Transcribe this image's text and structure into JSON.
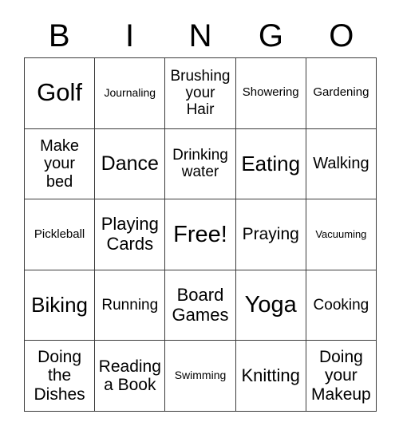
{
  "card": {
    "title_letters": [
      "B",
      "I",
      "N",
      "G",
      "O"
    ],
    "grid": {
      "columns": 5,
      "rows": 5,
      "line_color": "#3b3b3b",
      "background_color": "#ffffff",
      "text_color": "#000000"
    },
    "cells": [
      [
        {
          "label": "Golf",
          "size": "fs-31"
        },
        {
          "label": "Journaling",
          "size": "fs-14"
        },
        {
          "label": "Brushing\nyour\nHair",
          "size": "fs-19"
        },
        {
          "label": "Showering",
          "size": "fs-15"
        },
        {
          "label": "Gardening",
          "size": "fs-15"
        }
      ],
      [
        {
          "label": "Make\nyour\nbed",
          "size": "fs-20"
        },
        {
          "label": "Dance",
          "size": "fs-25"
        },
        {
          "label": "Drinking\nwater",
          "size": "fs-19"
        },
        {
          "label": "Eating",
          "size": "fs-26"
        },
        {
          "label": "Walking",
          "size": "fs-20"
        }
      ],
      [
        {
          "label": "Pickleball",
          "size": "fs-15"
        },
        {
          "label": "Playing\nCards",
          "size": "fs-22"
        },
        {
          "label": "Free!",
          "size": "fs-29"
        },
        {
          "label": "Praying",
          "size": "fs-21"
        },
        {
          "label": "Vacuuming",
          "size": "fs-13"
        }
      ],
      [
        {
          "label": "Biking",
          "size": "fs-26"
        },
        {
          "label": "Running",
          "size": "fs-19"
        },
        {
          "label": "Board\nGames",
          "size": "fs-22"
        },
        {
          "label": "Yoga",
          "size": "fs-29"
        },
        {
          "label": "Cooking",
          "size": "fs-19"
        }
      ],
      [
        {
          "label": "Doing\nthe\nDishes",
          "size": "fs-21"
        },
        {
          "label": "Reading\na Book",
          "size": "fs-21"
        },
        {
          "label": "Swimming",
          "size": "fs-14"
        },
        {
          "label": "Knitting",
          "size": "fs-22"
        },
        {
          "label": "Doing\nyour\nMakeup",
          "size": "fs-21"
        }
      ]
    ]
  }
}
